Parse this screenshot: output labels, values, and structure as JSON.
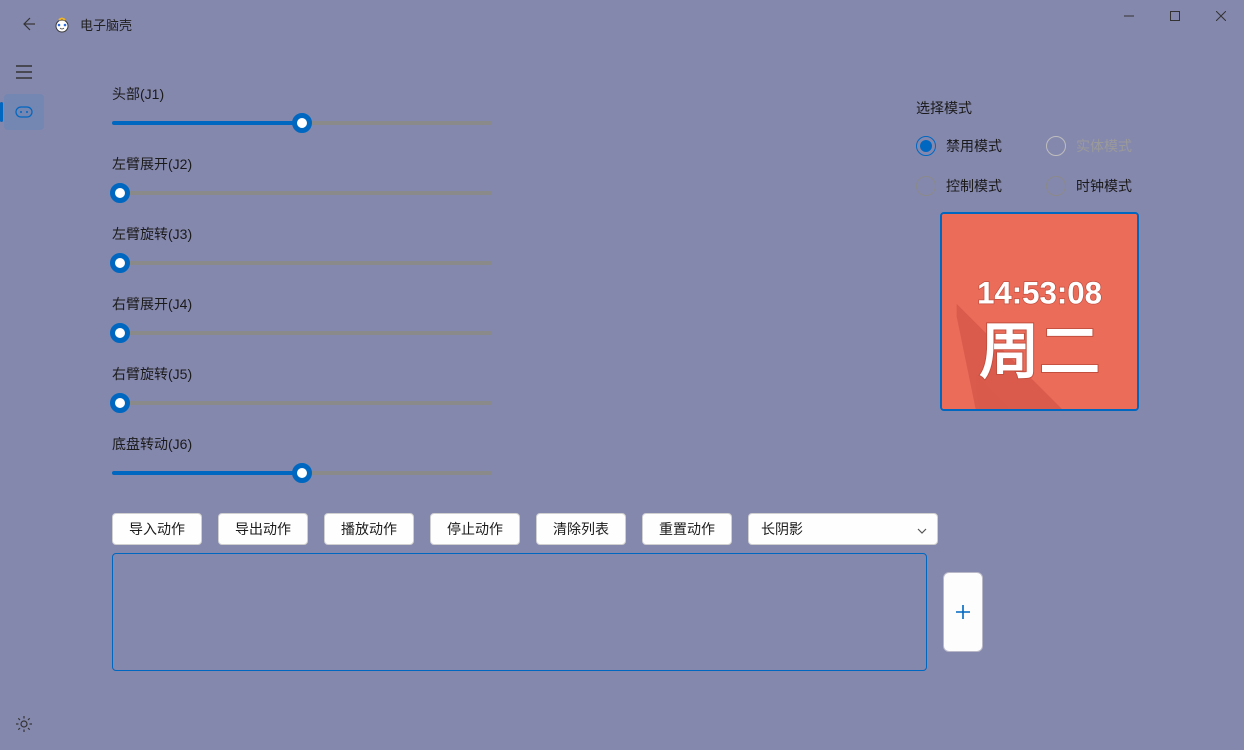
{
  "title": "电子脑壳",
  "sliders": [
    {
      "label": "头部(J1)",
      "value": 50
    },
    {
      "label": "左臂展开(J2)",
      "value": 0
    },
    {
      "label": "左臂旋转(J3)",
      "value": 0
    },
    {
      "label": "右臂展开(J4)",
      "value": 0
    },
    {
      "label": "右臂旋转(J5)",
      "value": 0
    },
    {
      "label": "底盘转动(J6)",
      "value": 50
    }
  ],
  "mode": {
    "title": "选择模式",
    "options": [
      {
        "label": "禁用模式",
        "selected": true,
        "disabled": false
      },
      {
        "label": "实体模式",
        "selected": false,
        "disabled": true
      },
      {
        "label": "控制模式",
        "selected": false,
        "disabled": false
      },
      {
        "label": "时钟模式",
        "selected": false,
        "disabled": false
      }
    ]
  },
  "clock": {
    "time": "14:53:08",
    "day": "周二"
  },
  "buttons": {
    "import": "导入动作",
    "export": "导出动作",
    "play": "播放动作",
    "stop": "停止动作",
    "clear": "清除列表",
    "reset": "重置动作"
  },
  "dropdown": {
    "selected": "长阴影"
  },
  "icons": {
    "back": "back-icon",
    "menu": "menu-icon",
    "controller": "controller-icon",
    "settings": "gear-icon",
    "minimize": "minimize-icon",
    "maximize": "maximize-icon",
    "close": "close-icon",
    "add": "add-icon",
    "chevronDown": "chevron-down-icon"
  }
}
